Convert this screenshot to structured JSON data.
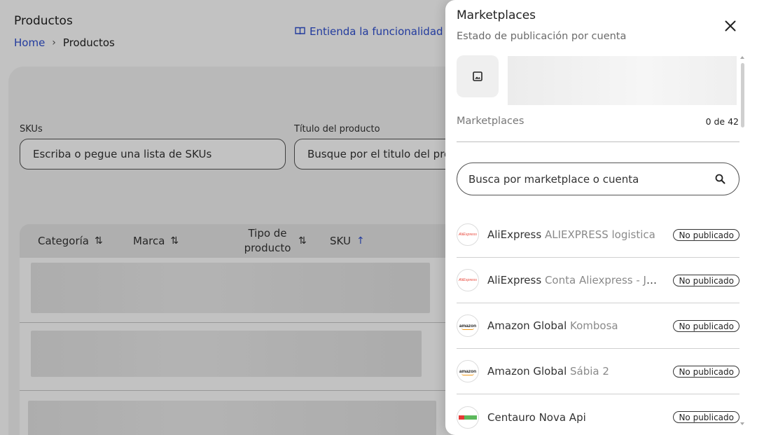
{
  "page": {
    "title": "Productos",
    "breadcrumb": {
      "home": "Home",
      "separator": "›",
      "current": "Productos"
    },
    "help_link": "Entienda la funcionalidad",
    "filters": {
      "skus_label": "SKUs",
      "skus_placeholder": "Escriba o pegue una lista de SKUs",
      "title_label": "Título del producto",
      "title_placeholder": "Busque por el titulo del producto"
    },
    "table": {
      "columns": [
        {
          "label": "Categoría",
          "sort": "⇅"
        },
        {
          "label": "Marca",
          "sort": "⇅"
        },
        {
          "label": "Tipo de producto",
          "sort": "⇅"
        },
        {
          "label": "SKU",
          "sort": "↑"
        }
      ]
    }
  },
  "drawer": {
    "title": "Marketplaces",
    "subtitle": "Estado de publicación por cuenta",
    "count_label": "Marketplaces",
    "count_value": "0 de 42",
    "search_placeholder": "Busca por marketplace o cuenta",
    "items": [
      {
        "logo": "aliexpress-logo",
        "logo_text": "AliExpress",
        "name": "AliExpress",
        "account": "ALIEXPRESS logistica",
        "status": "No publicado"
      },
      {
        "logo": "aliexpress-logo",
        "logo_text": "AliExpress",
        "name": "AliExpress",
        "account": "Conta Aliexpress - Jo...",
        "status": "No publicado"
      },
      {
        "logo": "amazon-logo",
        "logo_text": "amazon",
        "name": "Amazon Global",
        "account": "Kombosa",
        "status": "No publicado"
      },
      {
        "logo": "amazon-logo",
        "logo_text": "amazon",
        "name": "Amazon Global",
        "account": "Sábia 2",
        "status": "No publicado"
      },
      {
        "logo": "centauro-logo",
        "logo_text": "",
        "name": "Centauro Nova Api",
        "account": "",
        "status": "No publicado"
      }
    ]
  },
  "colors": {
    "accent": "#2f4fd0",
    "overlay": "rgba(0,0,0,0.24)"
  }
}
